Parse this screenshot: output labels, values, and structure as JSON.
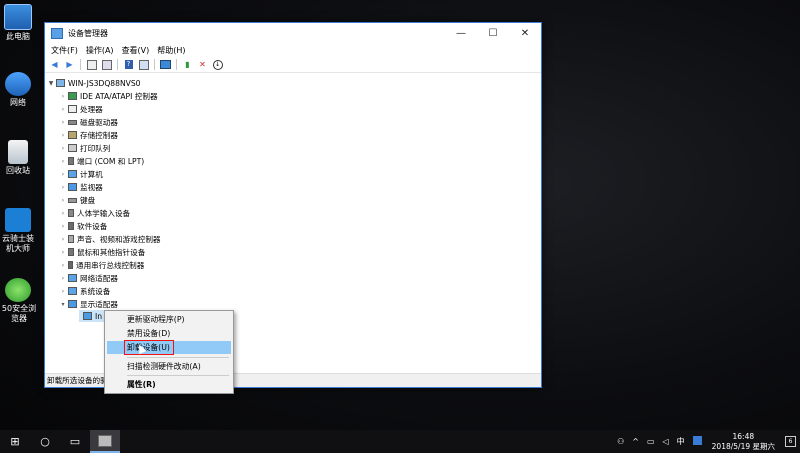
{
  "desktop": {
    "icons": [
      {
        "label": "此电脑",
        "icon": "computer-icon"
      },
      {
        "label": "网络",
        "icon": "network-icon"
      },
      {
        "label": "回收站",
        "icon": "recycle-bin-icon"
      },
      {
        "label": "云骑士装机大师",
        "icon": "installer-icon"
      },
      {
        "label": "50安全浏览器",
        "icon": "browser-icon"
      }
    ]
  },
  "window": {
    "title": "设备管理器",
    "controls": {
      "minimize": "—",
      "maximize": "☐",
      "close": "✕"
    },
    "menu": [
      "文件(F)",
      "操作(A)",
      "查看(V)",
      "帮助(H)"
    ],
    "toolbar_icons": [
      "back-icon",
      "forward-icon",
      "properties-icon",
      "list-icon",
      "help-icon",
      "view-icon",
      "monitor-icon",
      "update-driver-icon",
      "uninstall-icon",
      "scan-icon"
    ],
    "tree": {
      "root": "WIN-JS3DQ88NVS0",
      "items": [
        "IDE ATA/ATAPI 控制器",
        "处理器",
        "磁盘驱动器",
        "存储控制器",
        "打印队列",
        "端口 (COM 和 LPT)",
        "计算机",
        "监视器",
        "键盘",
        "人体学输入设备",
        "软件设备",
        "声音、视频和游戏控制器",
        "鼠标和其他指针设备",
        "通用串行总线控制器",
        "网络适配器",
        "系统设备",
        "显示适配器"
      ],
      "selected_child": "In"
    },
    "status": "卸载所选设备的驱"
  },
  "context_menu": {
    "items": [
      "更新驱动程序(P)",
      "禁用设备(D)",
      "卸载设备(U)",
      "扫描检测硬件改动(A)",
      "属性(R)"
    ],
    "highlighted": "卸载设备(U)"
  },
  "taskbar": {
    "start": "⊞",
    "search": "○",
    "task_view": "▭",
    "ime": "中",
    "time": "16:48",
    "date": "2018/5/19 星期六",
    "notification_count": "6"
  }
}
